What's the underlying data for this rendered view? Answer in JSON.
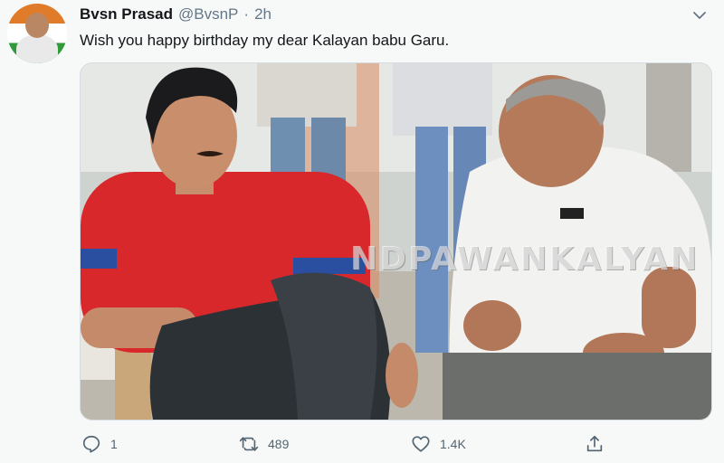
{
  "tweet": {
    "author_name": "Bvsn Prasad",
    "handle": "@BvsnP",
    "separator": "·",
    "time": "2h",
    "text": "Wish you happy birthday my dear Kalayan babu Garu.",
    "image_watermark": "NDPAWANKALYAN"
  },
  "actions": {
    "reply_count": "1",
    "retweet_count": "489",
    "like_count": "1.4K"
  },
  "icons": {
    "avatar": "avatar-image",
    "more": "chevron-down-icon",
    "reply": "reply-icon",
    "retweet": "retweet-icon",
    "like": "heart-icon",
    "share": "share-icon"
  },
  "colors": {
    "background": "#f7f9f9",
    "text_primary": "#14171a",
    "text_secondary": "#657786",
    "icon_gray": "#536471"
  }
}
